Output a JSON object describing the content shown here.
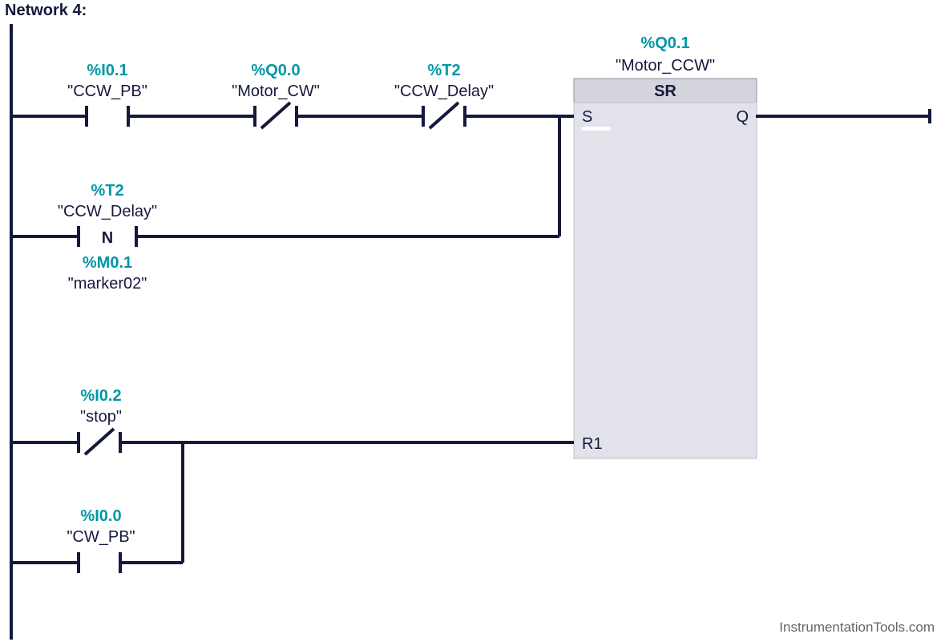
{
  "network_title": "Network 4:",
  "watermark": "InstrumentationTools.com",
  "contacts": {
    "ccw_pb": {
      "address": "%I0.1",
      "symbol": "\"CCW_PB\""
    },
    "motor_cw": {
      "address": "%Q0.0",
      "symbol": "\"Motor_CW\""
    },
    "ccw_delay": {
      "address": "%T2",
      "symbol": "\"CCW_Delay\""
    },
    "ccw_delay_n": {
      "address": "%T2",
      "symbol": "\"CCW_Delay\""
    },
    "marker02": {
      "address": "%M0.1",
      "symbol": "\"marker02\""
    },
    "stop": {
      "address": "%I0.2",
      "symbol": "\"stop\""
    },
    "cw_pb": {
      "address": "%I0.0",
      "symbol": "\"CW_PB\""
    },
    "n_edge_text": "N"
  },
  "block": {
    "address": "%Q0.1",
    "symbol": "\"Motor_CCW\"",
    "type": "SR",
    "set_pin": "S",
    "reset_pin": "R1",
    "output_pin": "Q"
  }
}
